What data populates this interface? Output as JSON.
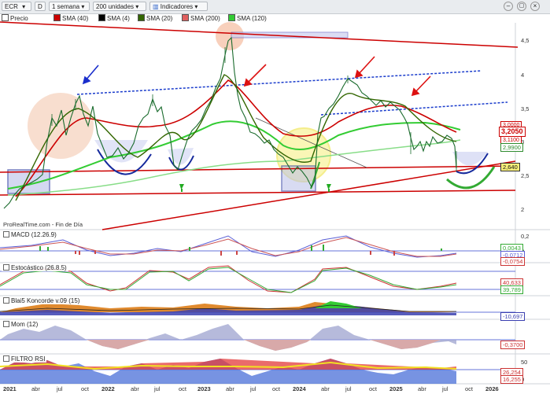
{
  "toolbar": {
    "symbol": "ECR",
    "symbol_icon": "chevron-down-icon",
    "exchange": "D",
    "period": "1 semana",
    "units": "200 unidades",
    "indicators": "Indicadores",
    "window_buttons": [
      "minimize-icon",
      "maximize-icon",
      "close-icon"
    ]
  },
  "legend": [
    {
      "label": "Precio",
      "color": "#ffffff"
    },
    {
      "label": "SMA (40)",
      "color": "#cc0000"
    },
    {
      "label": "SMA (4)",
      "color": "#000000"
    },
    {
      "label": "SMA (20)",
      "color": "#336600"
    },
    {
      "label": "SMA (200)",
      "color": "#e06060"
    },
    {
      "label": "SMA (120)",
      "color": "#33cc33"
    }
  ],
  "price_axis": {
    "ticks": [
      "4,5",
      "4",
      "3,5",
      "3",
      "2,5",
      "2"
    ]
  },
  "price_boxes": {
    "red_top": "3,0000",
    "main": "3,2050",
    "red_mid": "3,1100",
    "green": "2,9900",
    "yellow": "2,640"
  },
  "footer": "ProRealTime.com - Fin de Día",
  "panels": {
    "macd": {
      "label": "MACD (12.26.9)",
      "ticks": [
        "0,2",
        "0",
        "-0,2"
      ],
      "values": [
        "0,0043",
        "-0,0712",
        "-0,0754"
      ]
    },
    "stoch": {
      "label": "Estocástico (26.8.5)",
      "values": [
        "40,633",
        "39,789"
      ]
    },
    "blai5": {
      "label": "Blai5 Koncorde v.09 (15)",
      "values": [
        "-10,697"
      ]
    },
    "mom": {
      "label": "Mom (12)",
      "values": [
        "-0,3700"
      ]
    },
    "rsi": {
      "label": "FILTRO RSI",
      "ticks": [
        "50",
        "0"
      ],
      "values": [
        "26,254",
        "16,255"
      ]
    }
  },
  "x_axis": [
    {
      "label": "2021",
      "bold": true
    },
    {
      "label": "abr",
      "bold": false
    },
    {
      "label": "jul",
      "bold": false
    },
    {
      "label": "oct",
      "bold": false
    },
    {
      "label": "2022",
      "bold": true
    },
    {
      "label": "abr",
      "bold": false
    },
    {
      "label": "jul",
      "bold": false
    },
    {
      "label": "oct",
      "bold": false
    },
    {
      "label": "2023",
      "bold": true
    },
    {
      "label": "abr",
      "bold": false
    },
    {
      "label": "jul",
      "bold": false
    },
    {
      "label": "oct",
      "bold": false
    },
    {
      "label": "2024",
      "bold": true
    },
    {
      "label": "abr",
      "bold": false
    },
    {
      "label": "jul",
      "bold": false
    },
    {
      "label": "oct",
      "bold": false
    },
    {
      "label": "2025",
      "bold": true
    },
    {
      "label": "abr",
      "bold": false
    },
    {
      "label": "jul",
      "bold": false
    },
    {
      "label": "oct",
      "bold": false
    },
    {
      "label": "2026",
      "bold": true
    }
  ],
  "colors": {
    "up": "#2e8b57",
    "down": "#b22222",
    "trend": "#cc0000",
    "channel": "#1a3ccc"
  }
}
